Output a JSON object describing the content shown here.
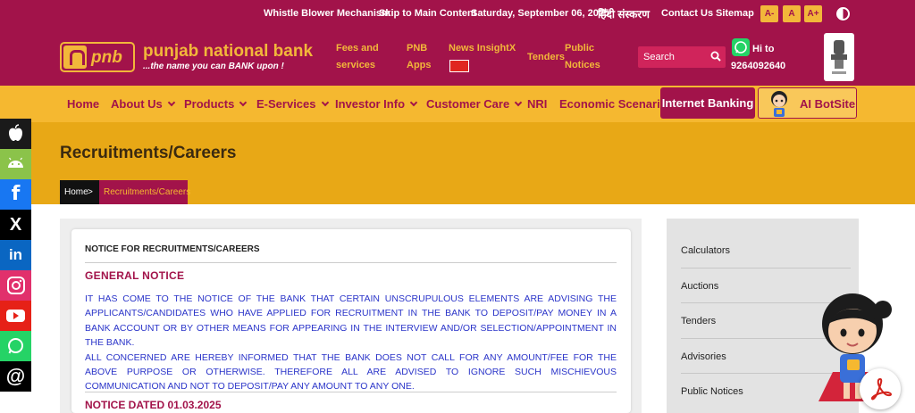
{
  "topbar": {
    "whistle": "Whistle Blower Mechanism",
    "skip": "Skip to Main Content",
    "date": "Saturday, September 06, 2025",
    "hindi": "हिंदी संस्करण",
    "contact": "Contact Us",
    "sitemap": "Sitemap",
    "font_decrease": "A-",
    "font_normal": "A",
    "font_increase": "A+",
    "contrast_icon": "contrast-icon"
  },
  "header": {
    "logo_text": "pnb",
    "bank_name": "punjab national bank",
    "tagline": "...the name you can BANK upon !",
    "links": {
      "fees_1": "Fees and",
      "fees_2": "services",
      "apps_1": "PNB",
      "apps_2": "Apps",
      "news": "News InsightX",
      "tenders": "Tenders",
      "public_1": "Public",
      "public_2": "Notices"
    },
    "search_placeholder": "Search",
    "whatsapp_1": "Hi to",
    "whatsapp_2": "9264092640",
    "emblem_icon": "national-emblem-icon"
  },
  "nav": {
    "items": [
      "Home",
      "About Us",
      "Products",
      "E-Services",
      "Investor Info",
      "Customer Care",
      "NRI",
      "Economic Scenario"
    ],
    "internet_banking": "Internet Banking",
    "ai_botsite": "AI BotSite"
  },
  "banner": {
    "title": "Recruitments/Careers",
    "breadcrumb_home": "Home",
    "breadcrumb_sep": ">",
    "breadcrumb_current": "Recruitments/Careers"
  },
  "social": [
    {
      "name": "apple-icon",
      "color": "#1a1a1a"
    },
    {
      "name": "android-icon",
      "color": "#8bc34a"
    },
    {
      "name": "facebook-icon",
      "color": "#1877f2"
    },
    {
      "name": "x-icon",
      "color": "#000000"
    },
    {
      "name": "linkedin-icon",
      "color": "#0a66c2"
    },
    {
      "name": "instagram-icon",
      "color": "#e1306c"
    },
    {
      "name": "youtube-icon",
      "color": "#e62117"
    },
    {
      "name": "whatsapp-icon",
      "color": "#25d366"
    },
    {
      "name": "threads-icon",
      "color": "#000000"
    }
  ],
  "content": {
    "card_heading": "NOTICE FOR RECRUITMENTS/CAREERS",
    "general_notice_title": "GENERAL NOTICE",
    "general_notice_p1": "IT HAS COME TO THE NOTICE OF THE BANK THAT CERTAIN UNSCRUPULOUS ELEMENTS ARE ADVISING THE APPLICANTS/CANDIDATES WHO HAVE APPLIED FOR RECRUITMENT IN THE BANK TO DEPOSIT/PAY MONEY IN A BANK ACCOUNT OR BY OTHER MEANS FOR APPEARING IN THE INTERVIEW AND/OR SELECTION/APPOINTMENT IN THE BANK.",
    "general_notice_p2": "ALL CONCERNED ARE HEREBY INFORMED THAT THE BANK DOES NOT CALL FOR ANY AMOUNT/FEE FOR THE ABOVE PURPOSE OR OTHERWISE. THEREFORE ALL ARE ADVISED TO IGNORE SUCH MISCHIEVOUS COMMUNICATION AND NOT TO DEPOSIT/PAY ANY AMOUNT TO ANY ONE.",
    "notice_dated": "NOTICE DATED 01.03.2025"
  },
  "sidebar": {
    "items": [
      "Calculators",
      "Auctions",
      "Tenders",
      "Advisories",
      "Public Notices"
    ]
  },
  "colors": {
    "brand_maroon": "#a2134a",
    "brand_gold": "#f5b830",
    "notice_blue": "#2b35c9"
  }
}
